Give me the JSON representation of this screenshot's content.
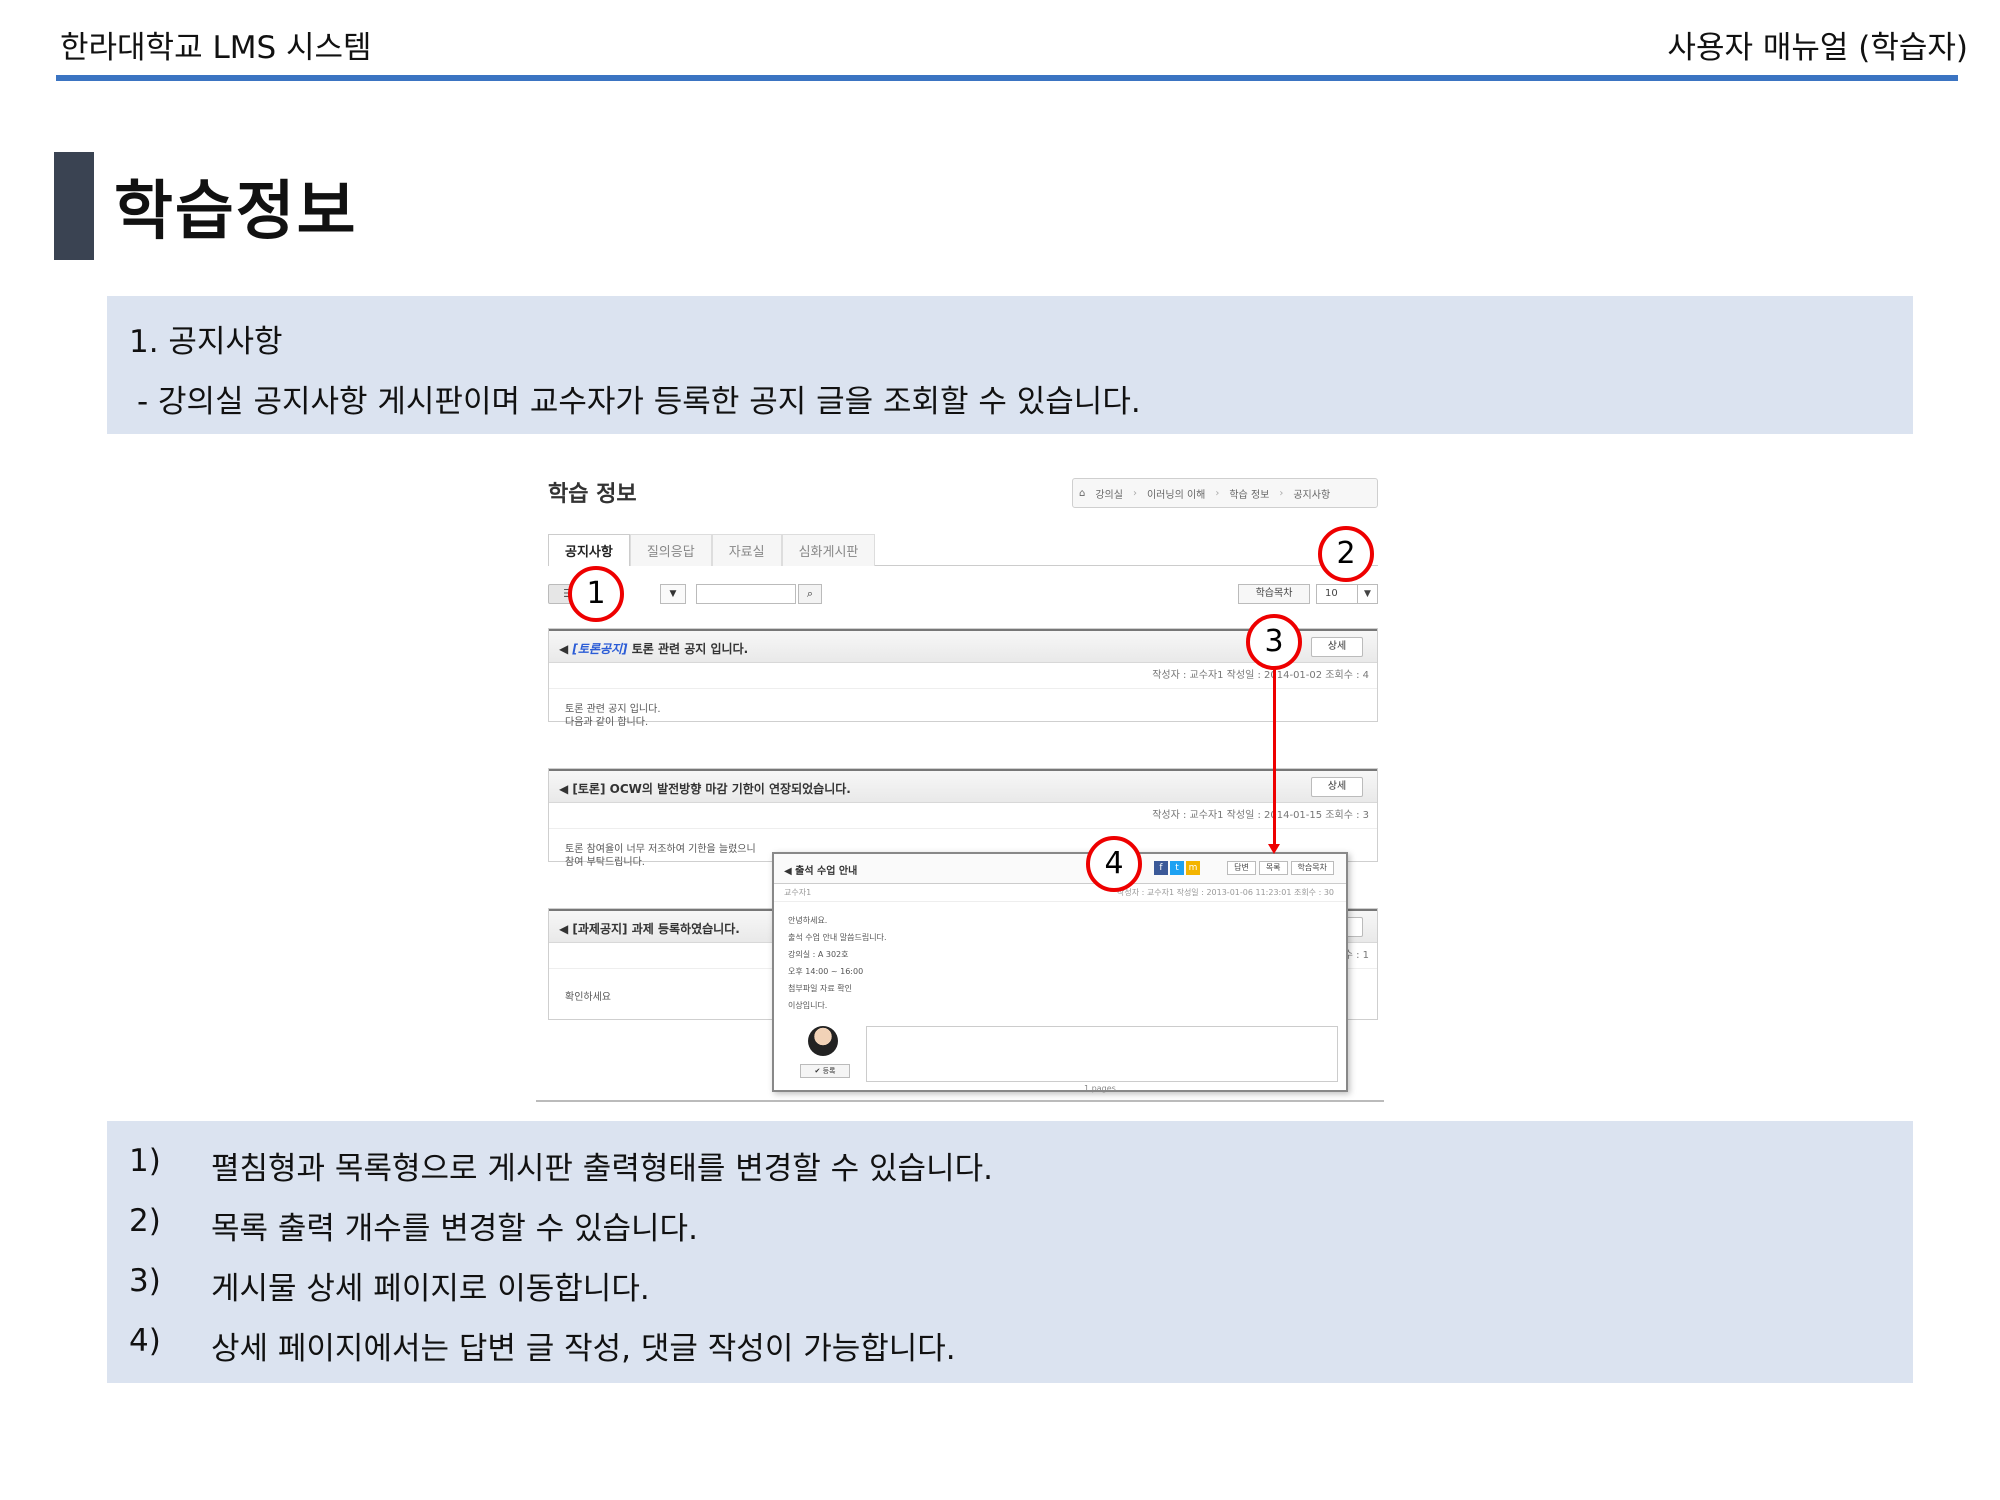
{
  "header": {
    "left": "한라대학교 LMS 시스템",
    "right": "사용자 매뉴얼 (학습자)"
  },
  "section": {
    "title": "학습정보"
  },
  "intro": {
    "heading": "1. 공지사항",
    "description": "- 강의실 공지사항 게시판이며 교수자가 등록한 공지 글을 조회할 수 있습니다."
  },
  "screenshot": {
    "title": "학습 정보",
    "breadcrumb": [
      "⌂",
      "강의실",
      "이러닝의 이해",
      "학습 정보",
      "공지사항"
    ],
    "tabs": [
      "공지사항",
      "질의응답",
      "자료실",
      "심화게시판"
    ],
    "toolbar": {
      "view_icon": "☰",
      "dropdown_arrow": "▼",
      "search_icon": "⌕",
      "list_button": "학습목차",
      "count_value": "10",
      "count_arrow": "▼"
    },
    "posts": [
      {
        "tag": "[토론공지]",
        "title": " 토론 관련 공지 입니다.",
        "detail": "상세",
        "meta": "작성자 : 교수자1   작성일 : 2014-01-02   조회수 : 4",
        "body_line1": "토론 관련 공지 입니다.",
        "body_line2": "다음과 같이 합니다."
      },
      {
        "tag": "",
        "title": "[토론] OCW의 발전방향 마감 기한이 연장되었습니다.",
        "detail": "상세",
        "meta": "작성자 : 교수자1   작성일 : 2014-01-15   조회수 : 3",
        "body_line1": "토론 참여율이 너무 저조하여 기한을 늘렸으니",
        "body_line2": "참여 부탁드립니다."
      },
      {
        "tag": "",
        "title": "[과제공지] 과제 등록하였습니다.",
        "detail": "상세",
        "meta": "조회수 : 1",
        "body_line1": "확인하세요",
        "body_line2": ""
      }
    ],
    "popup": {
      "title": "출석 수업 안내",
      "social": [
        "f",
        "t",
        "m"
      ],
      "buttons": [
        "답변",
        "목록",
        "학습목차"
      ],
      "meta_left": "교수자1",
      "meta_right": "작성자 : 교수자1   작성일 : 2013-01-06 11:23:01   조회수 : 30",
      "body": [
        "안녕하세요.",
        "출석 수업 안내 말씀드립니다.",
        "강의실 : A 302호",
        "오후 14:00 ~ 16:00",
        "첨부파일 자료 확인",
        "이상입니다."
      ],
      "register": "✔ 등록"
    },
    "pages_label": "1 pages",
    "callouts": [
      "1",
      "2",
      "3",
      "4"
    ]
  },
  "steps": [
    {
      "num": "1)",
      "text": "펼침형과 목록형으로 게시판 출력형태를 변경할 수 있습니다."
    },
    {
      "num": "2)",
      "text": "목록 출력 개수를 변경할 수 있습니다."
    },
    {
      "num": "3)",
      "text": "게시물 상세 페이지로 이동합니다."
    },
    {
      "num": "4)",
      "text": "상세 페이지에서는 답변 글 작성, 댓글 작성이 가능합니다."
    }
  ],
  "colors": {
    "accent_rule": "#3b74c2",
    "title_bar": "#3a4352",
    "info_box": "#dbe3f0",
    "callout": "#e00000"
  }
}
